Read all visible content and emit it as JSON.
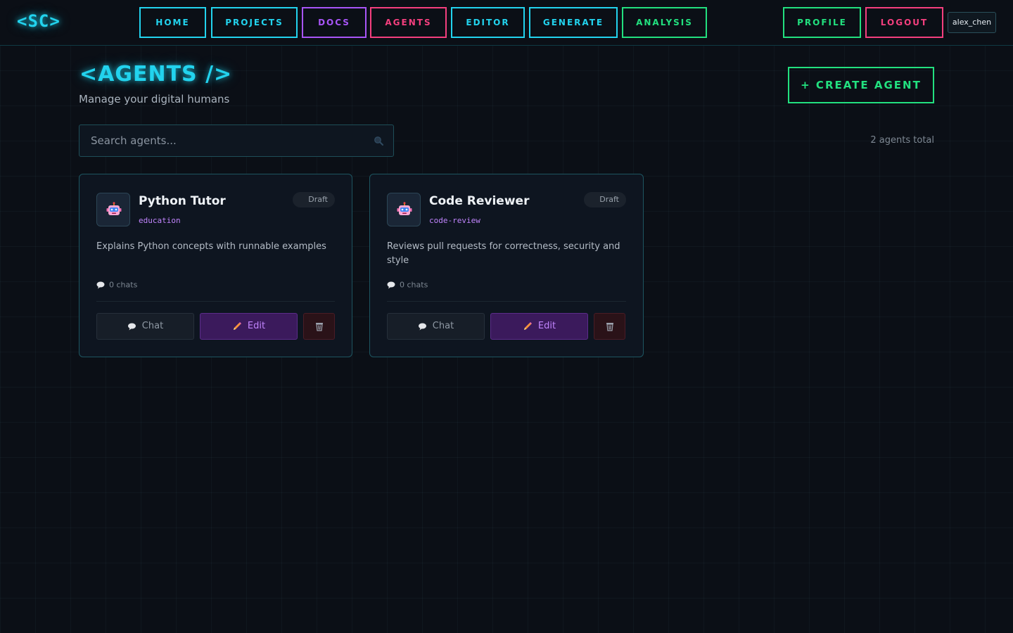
{
  "nav": {
    "logo": "<SC>",
    "items": [
      {
        "label": "HOME"
      },
      {
        "label": "PROJECTS"
      },
      {
        "label": "DOCS"
      },
      {
        "label": "AGENTS"
      },
      {
        "label": "EDITOR"
      },
      {
        "label": "GENERATE"
      },
      {
        "label": "ANALYSIS"
      }
    ],
    "profile": "PROFILE",
    "logout": "LOGOUT",
    "username": "alex_chen"
  },
  "header": {
    "title": "<AGENTS />",
    "subtitle": "Manage your digital humans",
    "create_label": "+ CREATE AGENT"
  },
  "search": {
    "placeholder": "Search agents...",
    "value": "",
    "total_label": "2 agents total"
  },
  "agents": [
    {
      "name": "Python Tutor",
      "tag": "education",
      "status": "Draft",
      "description": "Explains Python concepts with runnable examples",
      "chats": "0 chats",
      "chat_label": "Chat",
      "edit_label": "Edit"
    },
    {
      "name": "Code Reviewer",
      "tag": "code-review",
      "status": "Draft",
      "description": "Reviews pull requests for correctness, security and style",
      "chats": "0 chats",
      "chat_label": "Chat",
      "edit_label": "Edit"
    }
  ],
  "colors": {
    "cyan": "#22d3ee",
    "purple": "#a855f7",
    "pink": "#f43f7e",
    "green": "#22e07f",
    "background": "#0b0f16"
  }
}
